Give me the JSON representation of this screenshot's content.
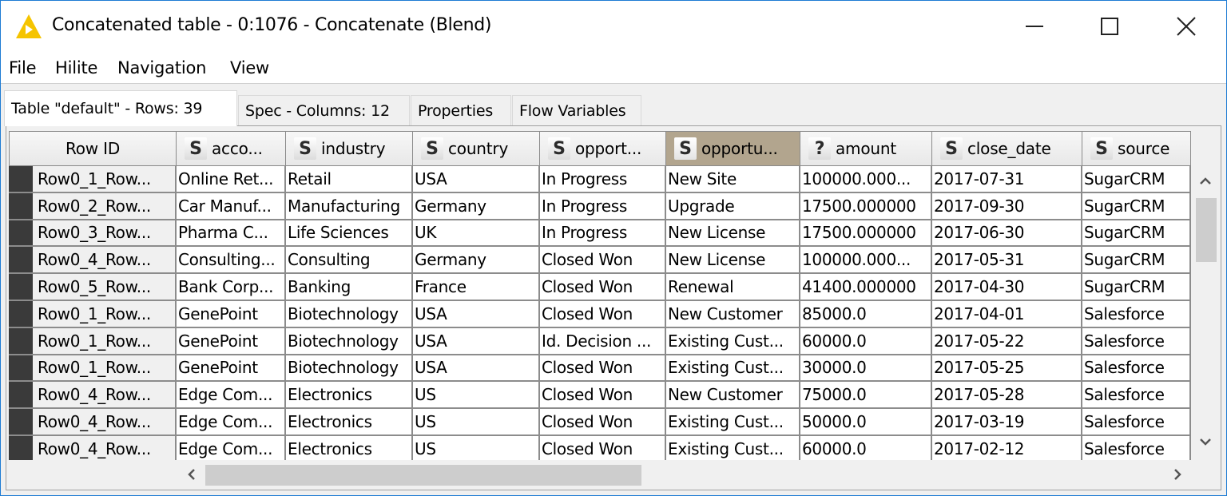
{
  "window": {
    "title": "Concatenated table - 0:1076 - Concatenate (Blend)",
    "app_icon": "knime-warning-triangle-icon",
    "accent_color": "#1e7bd3",
    "icon_color": "#f5c400"
  },
  "menu": {
    "items": [
      {
        "label": "File"
      },
      {
        "label": "Hilite"
      },
      {
        "label": "Navigation"
      },
      {
        "label": "View"
      }
    ]
  },
  "tabs": [
    {
      "label": "Table \"default\" - Rows: 39",
      "active": true
    },
    {
      "label": "Spec - Columns: 12",
      "active": false
    },
    {
      "label": "Properties",
      "active": false
    },
    {
      "label": "Flow Variables",
      "active": false
    }
  ],
  "table": {
    "rowid_header": "Row ID",
    "columns": [
      {
        "type_icon": "S",
        "label": "acco...",
        "selected": false
      },
      {
        "type_icon": "S",
        "label": "industry",
        "selected": false
      },
      {
        "type_icon": "S",
        "label": "country",
        "selected": false
      },
      {
        "type_icon": "S",
        "label": "opport...",
        "selected": false
      },
      {
        "type_icon": "S",
        "label": "opportu...",
        "selected": true
      },
      {
        "type_icon": "?",
        "label": "amount",
        "selected": false
      },
      {
        "type_icon": "S",
        "label": "close_date",
        "selected": false
      },
      {
        "type_icon": "S",
        "label": "source",
        "selected": false
      }
    ],
    "selected_header_color": "#b2a58e",
    "rows": [
      {
        "id": "Row0_1_Row...",
        "cells": [
          "Online Ret...",
          "Retail",
          "USA",
          "In Progress",
          "New Site",
          "100000.000...",
          "2017-07-31",
          "SugarCRM"
        ]
      },
      {
        "id": "Row0_2_Row...",
        "cells": [
          "Car Manuf...",
          "Manufacturing",
          "Germany",
          "In Progress",
          "Upgrade",
          "17500.000000",
          "2017-09-30",
          "SugarCRM"
        ]
      },
      {
        "id": "Row0_3_Row...",
        "cells": [
          "Pharma C...",
          "Life Sciences",
          "UK",
          "In Progress",
          "New License",
          "17500.000000",
          "2017-06-30",
          "SugarCRM"
        ]
      },
      {
        "id": "Row0_4_Row...",
        "cells": [
          "Consulting...",
          "Consulting",
          "Germany",
          "Closed Won",
          "New License",
          "100000.000...",
          "2017-05-31",
          "SugarCRM"
        ]
      },
      {
        "id": "Row0_5_Row...",
        "cells": [
          "Bank Corp...",
          "Banking",
          "France",
          "Closed Won",
          "Renewal",
          "41400.000000",
          "2017-04-30",
          "SugarCRM"
        ]
      },
      {
        "id": "Row0_1_Row...",
        "cells": [
          "GenePoint",
          "Biotechnology",
          "USA",
          "Closed Won",
          "New Customer",
          "85000.0",
          "2017-04-01",
          "Salesforce"
        ]
      },
      {
        "id": "Row0_1_Row...",
        "cells": [
          "GenePoint",
          "Biotechnology",
          "USA",
          "Id. Decision ...",
          "Existing Cust...",
          "60000.0",
          "2017-05-22",
          "Salesforce"
        ]
      },
      {
        "id": "Row0_1_Row...",
        "cells": [
          "GenePoint",
          "Biotechnology",
          "USA",
          "Closed Won",
          "Existing Cust...",
          "30000.0",
          "2017-05-25",
          "Salesforce"
        ]
      },
      {
        "id": "Row0_4_Row...",
        "cells": [
          "Edge Com...",
          "Electronics",
          "US",
          "Closed Won",
          "New Customer",
          "75000.0",
          "2017-05-28",
          "Salesforce"
        ]
      },
      {
        "id": "Row0_4_Row...",
        "cells": [
          "Edge Com...",
          "Electronics",
          "US",
          "Closed Won",
          "Existing Cust...",
          "50000.0",
          "2017-03-19",
          "Salesforce"
        ]
      },
      {
        "id": "Row0_4_Row...",
        "cells": [
          "Edge Com...",
          "Electronics",
          "US",
          "Closed Won",
          "Existing Cust...",
          "60000.0",
          "2017-02-12",
          "Salesforce"
        ]
      }
    ]
  },
  "scrollbars": {
    "vertical_position_fraction": 0.0,
    "horizontal_position_fraction": 0.0
  }
}
